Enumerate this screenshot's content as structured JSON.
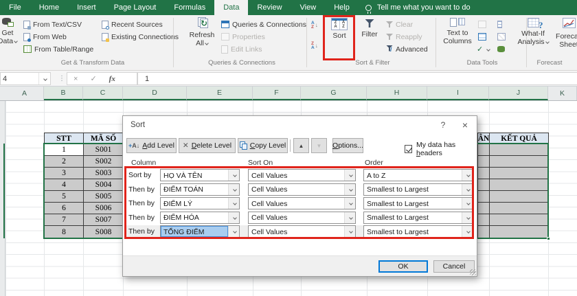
{
  "ribbon": {
    "tabs": [
      "File",
      "Home",
      "Insert",
      "Page Layout",
      "Formulas",
      "Data",
      "Review",
      "View",
      "Help"
    ],
    "tell_me": "Tell me what you want to do",
    "get_data_l1": "Get",
    "get_data_l2": "Data",
    "from_text_csv": "From Text/CSV",
    "from_web": "From Web",
    "from_table_range": "From Table/Range",
    "recent_sources": "Recent Sources",
    "existing_connections": "Existing Connections",
    "refresh_l1": "Refresh",
    "refresh_l2": "All",
    "queries_connections": "Queries & Connections",
    "properties": "Properties",
    "edit_links": "Edit Links",
    "sort": "Sort",
    "filter": "Filter",
    "clear": "Clear",
    "reapply": "Reapply",
    "advanced": "Advanced",
    "text_to_columns_l1": "Text to",
    "text_to_columns_l2": "Columns",
    "what_if_l1": "What-If",
    "what_if_l2": "Analysis",
    "forecast_l1": "Forecas",
    "forecast_l2": "Sheet",
    "group_labels": [
      "Get & Transform Data",
      "Queries & Connections",
      "Sort & Filter",
      "Data Tools",
      "Forecast"
    ]
  },
  "formula_bar": {
    "name_box": "4",
    "value": "1"
  },
  "sheet": {
    "columns": [
      "A",
      "B",
      "C",
      "D",
      "E",
      "F",
      "G",
      "H",
      "I",
      "J",
      "K"
    ],
    "table": {
      "left_headers": [
        "STT",
        "MÃ SỐ"
      ],
      "right_header_partial": "ÂN",
      "right_header": "KẾT QUẢ",
      "rows": [
        [
          "1",
          "S001"
        ],
        [
          "2",
          "S002"
        ],
        [
          "3",
          "S003"
        ],
        [
          "4",
          "S004"
        ],
        [
          "5",
          "S005"
        ],
        [
          "6",
          "S006"
        ],
        [
          "7",
          "S007"
        ],
        [
          "8",
          "S008"
        ]
      ]
    }
  },
  "dialog": {
    "title": "Sort",
    "help_glyph": "?",
    "close_glyph": "×",
    "toolbar": {
      "add_level": {
        "key": "A",
        "rest": "dd Level"
      },
      "delete_level": {
        "key": "D",
        "rest": "elete Level"
      },
      "copy_level": {
        "key": "C",
        "rest": "opy Level"
      },
      "options": {
        "key": "O",
        "rest": "ptions..."
      },
      "headers_label": {
        "pre": "My data has ",
        "key": "h",
        "post": "eaders"
      }
    },
    "columns": {
      "column": "Column",
      "sort_on": "Sort On",
      "order": "Order"
    },
    "levels": [
      {
        "label": "Sort by",
        "column": "HỌ VÀ TÊN",
        "sort_on": "Cell Values",
        "order": "A to Z"
      },
      {
        "label": "Then by",
        "column": "ĐIỂM TOÁN",
        "sort_on": "Cell Values",
        "order": "Smallest to Largest"
      },
      {
        "label": "Then by",
        "column": "ĐIỂM LÝ",
        "sort_on": "Cell Values",
        "order": "Smallest to Largest"
      },
      {
        "label": "Then by",
        "column": "ĐIỂM HÓA",
        "sort_on": "Cell Values",
        "order": "Smallest to Largest"
      },
      {
        "label": "Then by",
        "column": "TỔNG ĐIỂM",
        "sort_on": "Cell Values",
        "order": "Smallest to Largest"
      }
    ],
    "ok": "OK",
    "cancel": "Cancel"
  }
}
